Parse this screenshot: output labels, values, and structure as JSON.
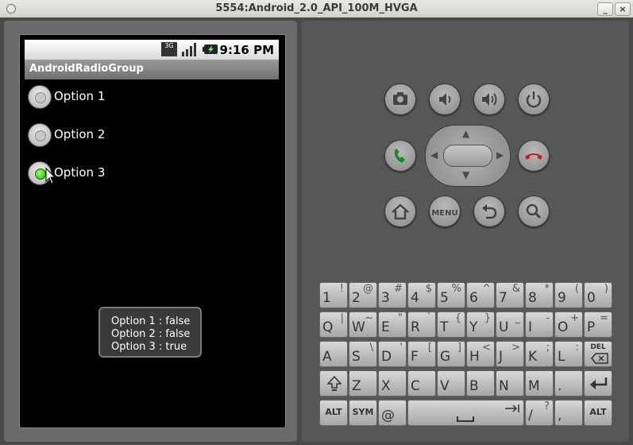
{
  "window": {
    "title": "5554:Android_2.0_API_100M_HVGA",
    "minimize": "_",
    "close": "×"
  },
  "statusbar": {
    "network": "3G",
    "time": "9:16 PM"
  },
  "app": {
    "title": "AndroidRadioGroup"
  },
  "radios": [
    {
      "label": "Option 1",
      "checked": false
    },
    {
      "label": "Option 2",
      "checked": false
    },
    {
      "label": "Option 3",
      "checked": true
    }
  ],
  "toast": {
    "line1": "Option 1 : false",
    "line2": "Option 2 : false",
    "line3": "Option 3 : true"
  },
  "controls": {
    "menu_label": "MENU"
  },
  "keyboard": {
    "row1": [
      [
        "1",
        "!"
      ],
      [
        "2",
        "@"
      ],
      [
        "3",
        "#"
      ],
      [
        "4",
        "$"
      ],
      [
        "5",
        "%"
      ],
      [
        "6",
        "^"
      ],
      [
        "7",
        "&"
      ],
      [
        "8",
        "*"
      ],
      [
        "9",
        "("
      ],
      [
        "0",
        ")"
      ]
    ],
    "row2": [
      [
        "Q",
        "|"
      ],
      [
        "W",
        "~"
      ],
      [
        "E",
        "\""
      ],
      [
        "R",
        "`"
      ],
      [
        "T",
        "{"
      ],
      [
        "Y",
        "}"
      ],
      [
        "U",
        "_"
      ],
      [
        "I",
        "-"
      ],
      [
        "O",
        "+"
      ],
      [
        "P",
        "="
      ]
    ],
    "row3": [
      [
        "A",
        ""
      ],
      [
        "S",
        "\\"
      ],
      [
        "D",
        "'"
      ],
      [
        "F",
        "["
      ],
      [
        "G",
        "]"
      ],
      [
        "H",
        "<"
      ],
      [
        "J",
        ">"
      ],
      [
        "K",
        ";"
      ],
      [
        "L",
        ":"
      ]
    ],
    "row4": [
      "Z",
      "X",
      "C",
      "V",
      "B",
      "N",
      "M",
      "."
    ],
    "del_label": "DEL",
    "alt_label": "ALT",
    "sym_label": "SYM",
    "at_label": "@",
    "slash_label": "/",
    "slash_alt": "?",
    "comma_label": ","
  }
}
